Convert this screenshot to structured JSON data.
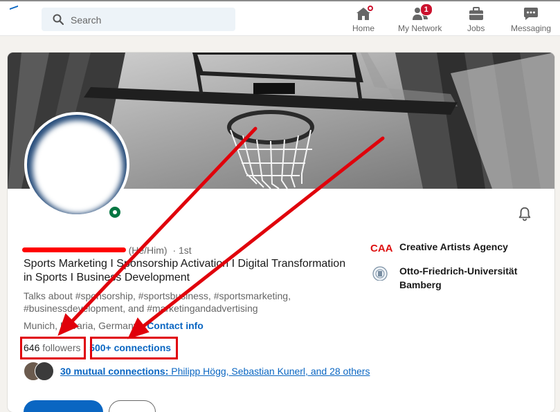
{
  "nav": {
    "search_placeholder": "Search",
    "items": [
      {
        "label": "Home",
        "icon": "home-icon",
        "badge": ""
      },
      {
        "label": "My Network",
        "icon": "network-icon",
        "badge": "1"
      },
      {
        "label": "Jobs",
        "icon": "briefcase-icon",
        "badge": ""
      },
      {
        "label": "Messaging",
        "icon": "messaging-icon",
        "badge": ""
      }
    ]
  },
  "profile": {
    "pronouns": "(He/Him)",
    "degree": "· 1st",
    "headline": "Sports Marketing I Sponsorship Activation I Digital Transformation in Sports I Business Development",
    "talks_about": "Talks about #sponsorship, #sportsbusiness, #sportsmarketing, #businessdevelopment, and #marketingandadvertising",
    "location": "Munich, Bavaria, Germany",
    "location_sep": " · ",
    "contact_info": "Contact info",
    "followers_count": "646",
    "followers_label": "followers",
    "stats_sep": "·",
    "connections": "500+ connections",
    "mutual_prefix": "30 mutual connections:",
    "mutual_names": " Philipp Högg, Sebastian Kunerl, and 28 others"
  },
  "experience": [
    {
      "logo_text": "CAA",
      "name": "Creative Artists Agency",
      "icon": "caa-logo"
    },
    {
      "logo_text": "",
      "name": "Otto-Friedrich-Universität Bamberg",
      "icon": "university-seal-logo"
    }
  ],
  "colors": {
    "accent": "#0a66c2",
    "annotation": "#e0000b",
    "online": "#057642",
    "badge": "#cb112d"
  }
}
